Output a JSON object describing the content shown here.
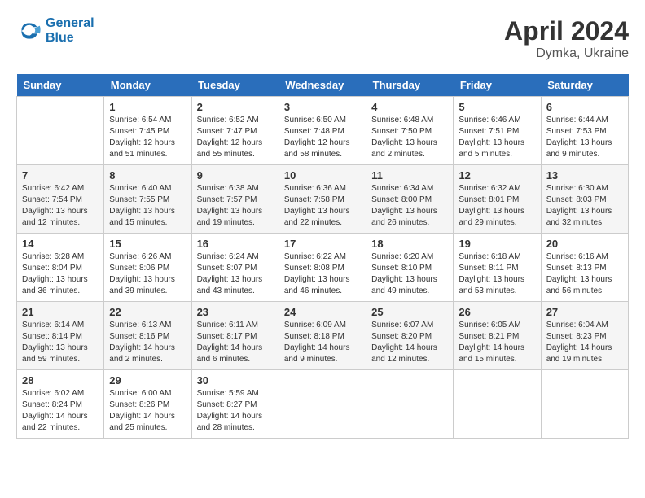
{
  "logo": {
    "line1": "General",
    "line2": "Blue"
  },
  "title": "April 2024",
  "subtitle": "Dymka, Ukraine",
  "weekdays": [
    "Sunday",
    "Monday",
    "Tuesday",
    "Wednesday",
    "Thursday",
    "Friday",
    "Saturday"
  ],
  "weeks": [
    [
      {
        "day": "",
        "sunrise": "",
        "sunset": "",
        "daylight": ""
      },
      {
        "day": "1",
        "sunrise": "Sunrise: 6:54 AM",
        "sunset": "Sunset: 7:45 PM",
        "daylight": "Daylight: 12 hours and 51 minutes."
      },
      {
        "day": "2",
        "sunrise": "Sunrise: 6:52 AM",
        "sunset": "Sunset: 7:47 PM",
        "daylight": "Daylight: 12 hours and 55 minutes."
      },
      {
        "day": "3",
        "sunrise": "Sunrise: 6:50 AM",
        "sunset": "Sunset: 7:48 PM",
        "daylight": "Daylight: 12 hours and 58 minutes."
      },
      {
        "day": "4",
        "sunrise": "Sunrise: 6:48 AM",
        "sunset": "Sunset: 7:50 PM",
        "daylight": "Daylight: 13 hours and 2 minutes."
      },
      {
        "day": "5",
        "sunrise": "Sunrise: 6:46 AM",
        "sunset": "Sunset: 7:51 PM",
        "daylight": "Daylight: 13 hours and 5 minutes."
      },
      {
        "day": "6",
        "sunrise": "Sunrise: 6:44 AM",
        "sunset": "Sunset: 7:53 PM",
        "daylight": "Daylight: 13 hours and 9 minutes."
      }
    ],
    [
      {
        "day": "7",
        "sunrise": "Sunrise: 6:42 AM",
        "sunset": "Sunset: 7:54 PM",
        "daylight": "Daylight: 13 hours and 12 minutes."
      },
      {
        "day": "8",
        "sunrise": "Sunrise: 6:40 AM",
        "sunset": "Sunset: 7:55 PM",
        "daylight": "Daylight: 13 hours and 15 minutes."
      },
      {
        "day": "9",
        "sunrise": "Sunrise: 6:38 AM",
        "sunset": "Sunset: 7:57 PM",
        "daylight": "Daylight: 13 hours and 19 minutes."
      },
      {
        "day": "10",
        "sunrise": "Sunrise: 6:36 AM",
        "sunset": "Sunset: 7:58 PM",
        "daylight": "Daylight: 13 hours and 22 minutes."
      },
      {
        "day": "11",
        "sunrise": "Sunrise: 6:34 AM",
        "sunset": "Sunset: 8:00 PM",
        "daylight": "Daylight: 13 hours and 26 minutes."
      },
      {
        "day": "12",
        "sunrise": "Sunrise: 6:32 AM",
        "sunset": "Sunset: 8:01 PM",
        "daylight": "Daylight: 13 hours and 29 minutes."
      },
      {
        "day": "13",
        "sunrise": "Sunrise: 6:30 AM",
        "sunset": "Sunset: 8:03 PM",
        "daylight": "Daylight: 13 hours and 32 minutes."
      }
    ],
    [
      {
        "day": "14",
        "sunrise": "Sunrise: 6:28 AM",
        "sunset": "Sunset: 8:04 PM",
        "daylight": "Daylight: 13 hours and 36 minutes."
      },
      {
        "day": "15",
        "sunrise": "Sunrise: 6:26 AM",
        "sunset": "Sunset: 8:06 PM",
        "daylight": "Daylight: 13 hours and 39 minutes."
      },
      {
        "day": "16",
        "sunrise": "Sunrise: 6:24 AM",
        "sunset": "Sunset: 8:07 PM",
        "daylight": "Daylight: 13 hours and 43 minutes."
      },
      {
        "day": "17",
        "sunrise": "Sunrise: 6:22 AM",
        "sunset": "Sunset: 8:08 PM",
        "daylight": "Daylight: 13 hours and 46 minutes."
      },
      {
        "day": "18",
        "sunrise": "Sunrise: 6:20 AM",
        "sunset": "Sunset: 8:10 PM",
        "daylight": "Daylight: 13 hours and 49 minutes."
      },
      {
        "day": "19",
        "sunrise": "Sunrise: 6:18 AM",
        "sunset": "Sunset: 8:11 PM",
        "daylight": "Daylight: 13 hours and 53 minutes."
      },
      {
        "day": "20",
        "sunrise": "Sunrise: 6:16 AM",
        "sunset": "Sunset: 8:13 PM",
        "daylight": "Daylight: 13 hours and 56 minutes."
      }
    ],
    [
      {
        "day": "21",
        "sunrise": "Sunrise: 6:14 AM",
        "sunset": "Sunset: 8:14 PM",
        "daylight": "Daylight: 13 hours and 59 minutes."
      },
      {
        "day": "22",
        "sunrise": "Sunrise: 6:13 AM",
        "sunset": "Sunset: 8:16 PM",
        "daylight": "Daylight: 14 hours and 2 minutes."
      },
      {
        "day": "23",
        "sunrise": "Sunrise: 6:11 AM",
        "sunset": "Sunset: 8:17 PM",
        "daylight": "Daylight: 14 hours and 6 minutes."
      },
      {
        "day": "24",
        "sunrise": "Sunrise: 6:09 AM",
        "sunset": "Sunset: 8:18 PM",
        "daylight": "Daylight: 14 hours and 9 minutes."
      },
      {
        "day": "25",
        "sunrise": "Sunrise: 6:07 AM",
        "sunset": "Sunset: 8:20 PM",
        "daylight": "Daylight: 14 hours and 12 minutes."
      },
      {
        "day": "26",
        "sunrise": "Sunrise: 6:05 AM",
        "sunset": "Sunset: 8:21 PM",
        "daylight": "Daylight: 14 hours and 15 minutes."
      },
      {
        "day": "27",
        "sunrise": "Sunrise: 6:04 AM",
        "sunset": "Sunset: 8:23 PM",
        "daylight": "Daylight: 14 hours and 19 minutes."
      }
    ],
    [
      {
        "day": "28",
        "sunrise": "Sunrise: 6:02 AM",
        "sunset": "Sunset: 8:24 PM",
        "daylight": "Daylight: 14 hours and 22 minutes."
      },
      {
        "day": "29",
        "sunrise": "Sunrise: 6:00 AM",
        "sunset": "Sunset: 8:26 PM",
        "daylight": "Daylight: 14 hours and 25 minutes."
      },
      {
        "day": "30",
        "sunrise": "Sunrise: 5:59 AM",
        "sunset": "Sunset: 8:27 PM",
        "daylight": "Daylight: 14 hours and 28 minutes."
      },
      {
        "day": "",
        "sunrise": "",
        "sunset": "",
        "daylight": ""
      },
      {
        "day": "",
        "sunrise": "",
        "sunset": "",
        "daylight": ""
      },
      {
        "day": "",
        "sunrise": "",
        "sunset": "",
        "daylight": ""
      },
      {
        "day": "",
        "sunrise": "",
        "sunset": "",
        "daylight": ""
      }
    ]
  ]
}
